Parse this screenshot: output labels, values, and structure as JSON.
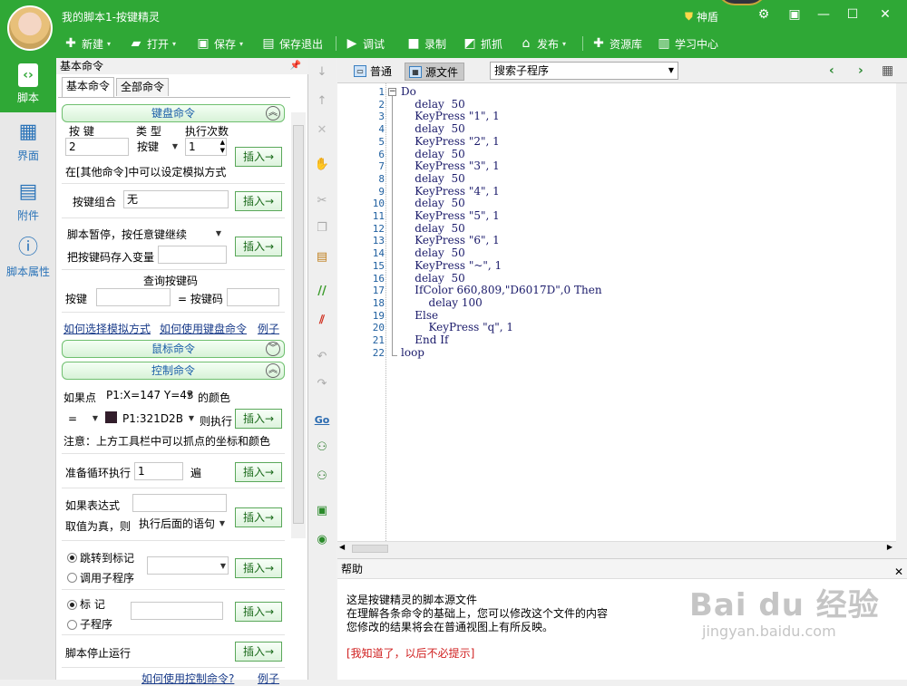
{
  "window": {
    "title": "我的脚本1-按键精灵",
    "badge": "神盾"
  },
  "toolbar": {
    "new": "新建",
    "open": "打开",
    "save": "保存",
    "save_exit": "保存退出",
    "debug": "调试",
    "record": "录制",
    "grab": "抓抓",
    "publish": "发布",
    "library": "资源库",
    "learn": "学习中心"
  },
  "leftnav": [
    {
      "label": "脚本",
      "icon": "script-icon"
    },
    {
      "label": "界面",
      "icon": "grid-icon"
    },
    {
      "label": "附件",
      "icon": "attachment-icon"
    },
    {
      "label": "脚本属性",
      "icon": "info-icon"
    }
  ],
  "cmdpanel": {
    "header": "基本命令",
    "tabs": [
      "基本命令",
      "全部命令"
    ],
    "keyboard": {
      "section": "键盘命令",
      "col_key": "按 键",
      "col_type": "类 型",
      "col_count": "执行次数",
      "key_value": "2",
      "type_value": "按键",
      "count_value": "1",
      "note": "在[其他命令]中可以设定模拟方式",
      "combo_label": "按键组合",
      "combo_value": "无",
      "pause_label": "脚本暂停，按任意键继续",
      "store_label": "把按键码存入变量",
      "query_title": "查询按键码",
      "query_key": "按键",
      "query_code": "= 按键码",
      "link1": "如何选择模拟方式",
      "link2": "如何使用键盘命令",
      "link3": "例子"
    },
    "mouse": {
      "section": "鼠标命令"
    },
    "control": {
      "section": "控制命令",
      "if_point_label": "如果点",
      "point_value": "P1:X=147 Y=43",
      "color_suffix": "的颜色",
      "op_value": "=",
      "color_value": "P1:321D2B",
      "then_label": "则执行",
      "note": "注意：上方工具栏中可以抓点的坐标和颜色",
      "loop_label": "准备循环执行",
      "loop_value": "1",
      "loop_unit": "遍",
      "expr_label": "如果表达式",
      "expr_true": "取值为真，则",
      "expr_action": "执行后面的语句",
      "jump_label": "跳转到标记",
      "call_label": "调用子程序",
      "mark_label": "标 记",
      "sub_label": "子程序",
      "stop_label": "脚本停止运行",
      "bottom_link": "如何使用控制命令?",
      "bottom_example": "例子"
    },
    "insert": "插入→"
  },
  "editor": {
    "tabs": [
      "普通",
      "源文件"
    ],
    "sub_select": "搜索子程序",
    "lines": [
      "Do",
      "    delay  50",
      "    KeyPress \"1\", 1",
      "    delay  50",
      "    KeyPress \"2\", 1",
      "    delay  50",
      "    KeyPress \"3\", 1",
      "    delay  50",
      "    KeyPress \"4\", 1",
      "    delay  50",
      "    KeyPress \"5\", 1",
      "    delay  50",
      "    KeyPress \"6\", 1",
      "    delay  50",
      "    KeyPress \"~\", 1",
      "    delay  50",
      "    IfColor 660,809,\"D6017D\",0 Then",
      "        delay 100",
      "    Else",
      "        KeyPress \"q\", 1",
      "    End If",
      "loop"
    ]
  },
  "help": {
    "title": "帮助",
    "lines": [
      "这是按键精灵的脚本源文件",
      "在理解各条命令的基础上，您可以修改这个文件的内容",
      "您修改的结果将会在普通视图上有所反映。"
    ],
    "dismiss": "[我知道了，以后不必提示]"
  },
  "watermark": {
    "main": "Bai du 经验",
    "sub": "jingyan.baidu.com"
  },
  "colors": {
    "accent": "#2fa836",
    "link": "#1a3c8a",
    "code": "#1a1a6a",
    "warning": "#d02020"
  }
}
